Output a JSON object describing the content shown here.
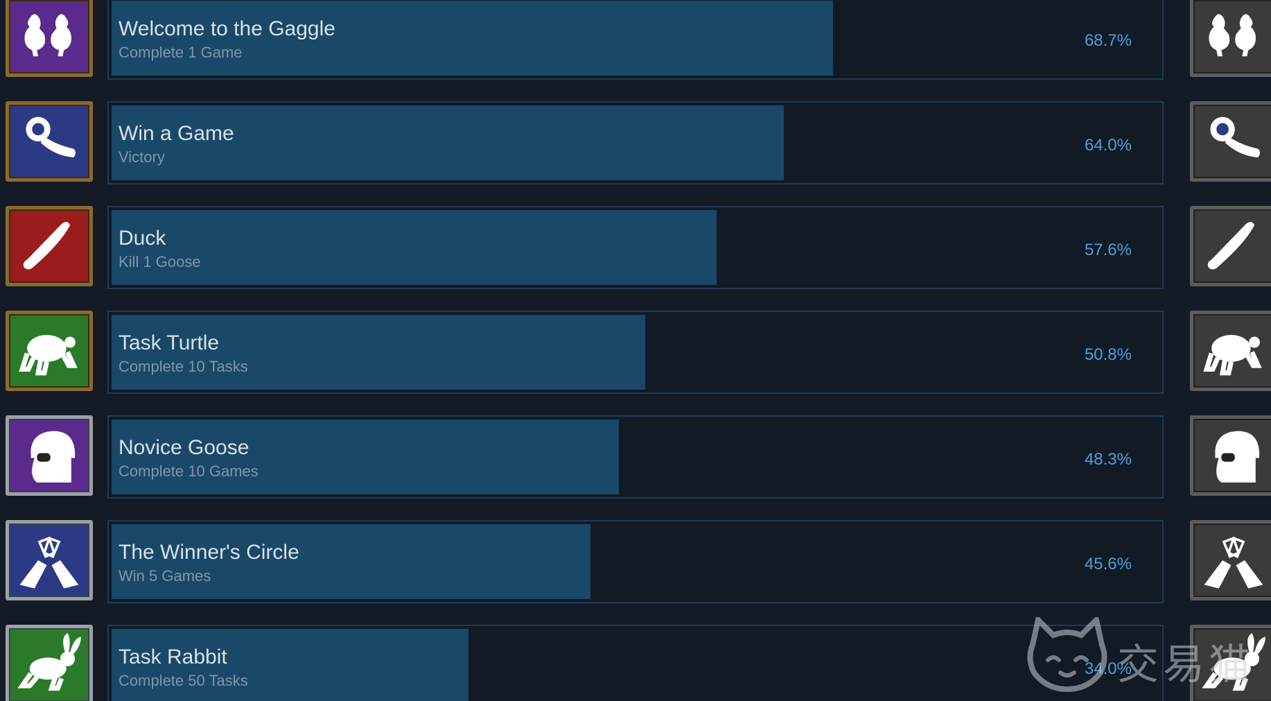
{
  "colors": {
    "background": "#141b26",
    "bar_fill": "#1a4868",
    "bar_border": "#1f3a55",
    "title_text": "#d8e2ec",
    "desc_text": "#7f96ad",
    "percent_text": "#4aa0d8"
  },
  "achievements": [
    {
      "title": "Welcome to the Gaggle",
      "desc": "Complete 1 Game",
      "percent": "68.7%",
      "fraction": 0.687,
      "icon": "two-geese-icon",
      "icon_color": "purple",
      "frame": "gold"
    },
    {
      "title": "Win a Game",
      "desc": "Victory",
      "percent": "64.0%",
      "fraction": 0.64,
      "icon": "ribbon-rosette-icon",
      "icon_color": "blue",
      "frame": "gold"
    },
    {
      "title": "Duck",
      "desc": "Kill 1 Goose",
      "percent": "57.6%",
      "fraction": 0.576,
      "icon": "knife-icon",
      "icon_color": "red",
      "frame": "gold"
    },
    {
      "title": "Task Turtle",
      "desc": "Complete 10 Tasks",
      "percent": "50.8%",
      "fraction": 0.508,
      "icon": "turtle-icon",
      "icon_color": "green",
      "frame": "gold"
    },
    {
      "title": "Novice Goose",
      "desc": "Complete 10 Games",
      "percent": "48.3%",
      "fraction": 0.483,
      "icon": "goose-pilot-helmet-icon",
      "icon_color": "purple",
      "frame": "silver"
    },
    {
      "title": "The Winner's Circle",
      "desc": "Win 5 Games",
      "percent": "45.6%",
      "fraction": 0.456,
      "icon": "clinking-glasses-icon",
      "icon_color": "blue",
      "frame": "silver"
    },
    {
      "title": "Task Rabbit",
      "desc": "Complete 50 Tasks",
      "percent": "34.0%",
      "fraction": 0.34,
      "icon": "rabbit-icon",
      "icon_color": "green",
      "frame": "silver"
    }
  ],
  "watermark": {
    "text": "交易猫",
    "icon": "cat-face-icon"
  }
}
